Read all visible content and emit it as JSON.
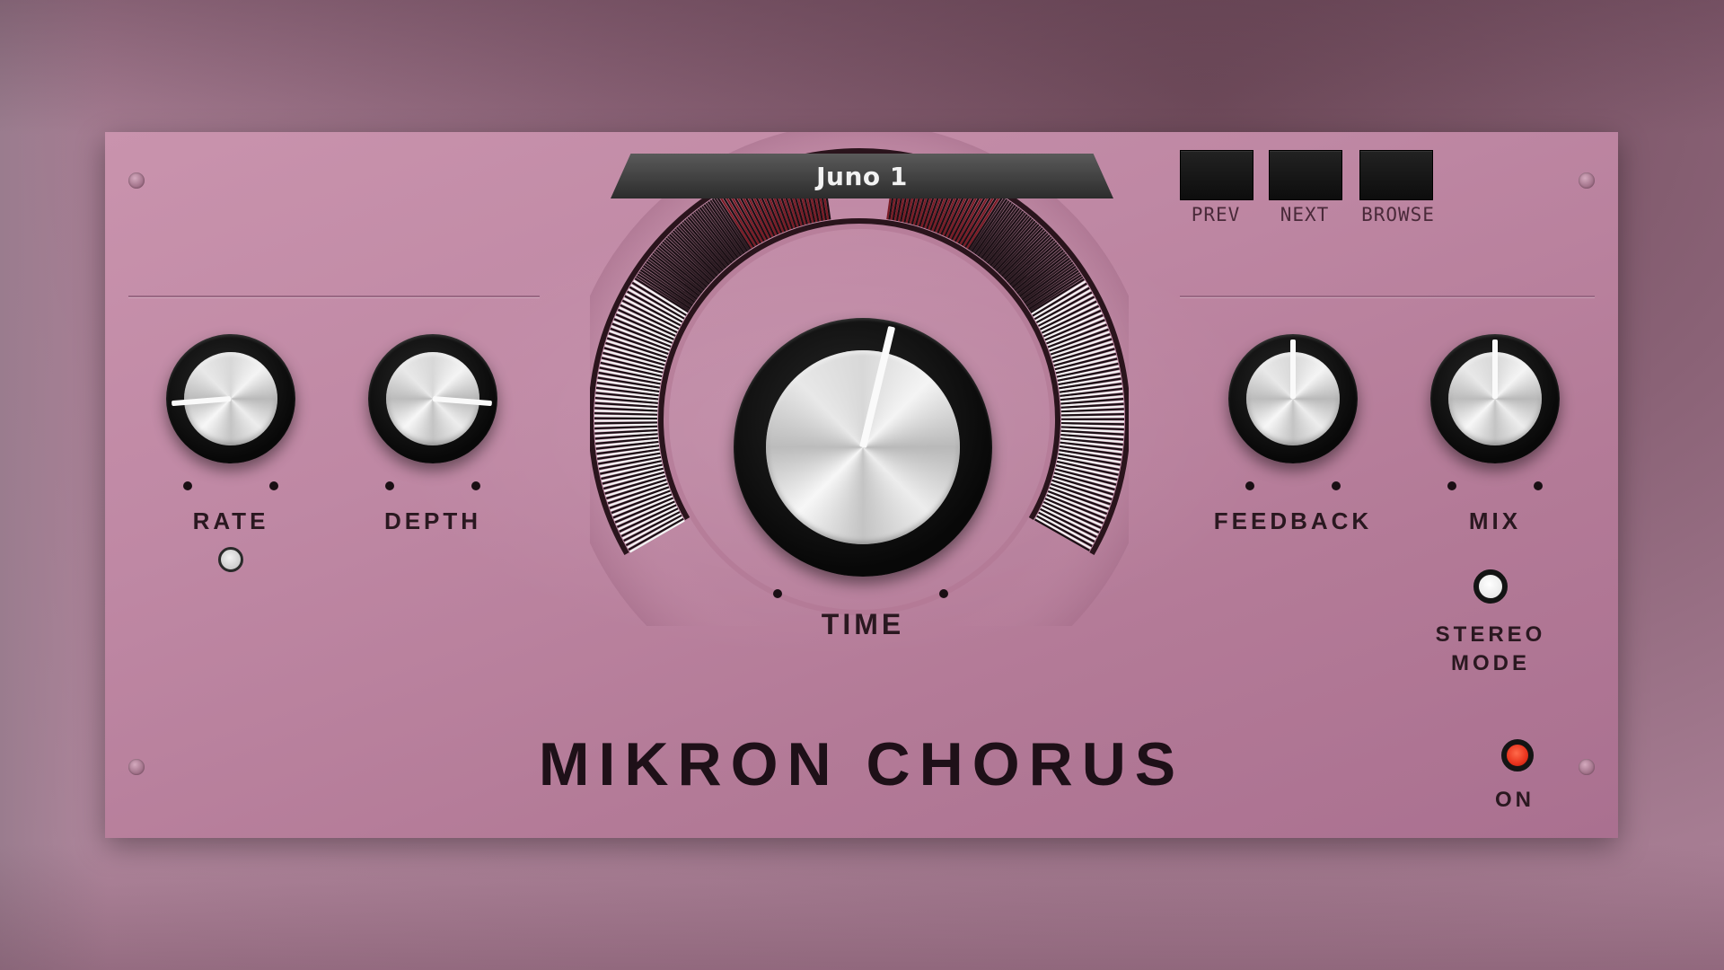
{
  "preset": {
    "name": "Juno 1"
  },
  "nav": {
    "prev": "PREV",
    "next": "NEXT",
    "browse": "BROWSE"
  },
  "controls": {
    "rate": {
      "label": "RATE",
      "value": 0.15
    },
    "depth": {
      "label": "DEPTH",
      "value": 0.85
    },
    "time": {
      "label": "TIME",
      "value": 0.55
    },
    "feedback": {
      "label": "FEEDBACK",
      "value": 0.5
    },
    "mix": {
      "label": "MIX",
      "value": 0.5
    }
  },
  "stereo_mode": {
    "label_line1": "STEREO",
    "label_line2": "MODE"
  },
  "power": {
    "label": "ON"
  },
  "title": "MIKRON CHORUS",
  "colors": {
    "panel": "#bf88a4",
    "power_led": "#e8321c",
    "meter_active": "#7a1b24"
  },
  "icons": {
    "screw": "screw-icon",
    "led": "led-indicator-icon"
  }
}
